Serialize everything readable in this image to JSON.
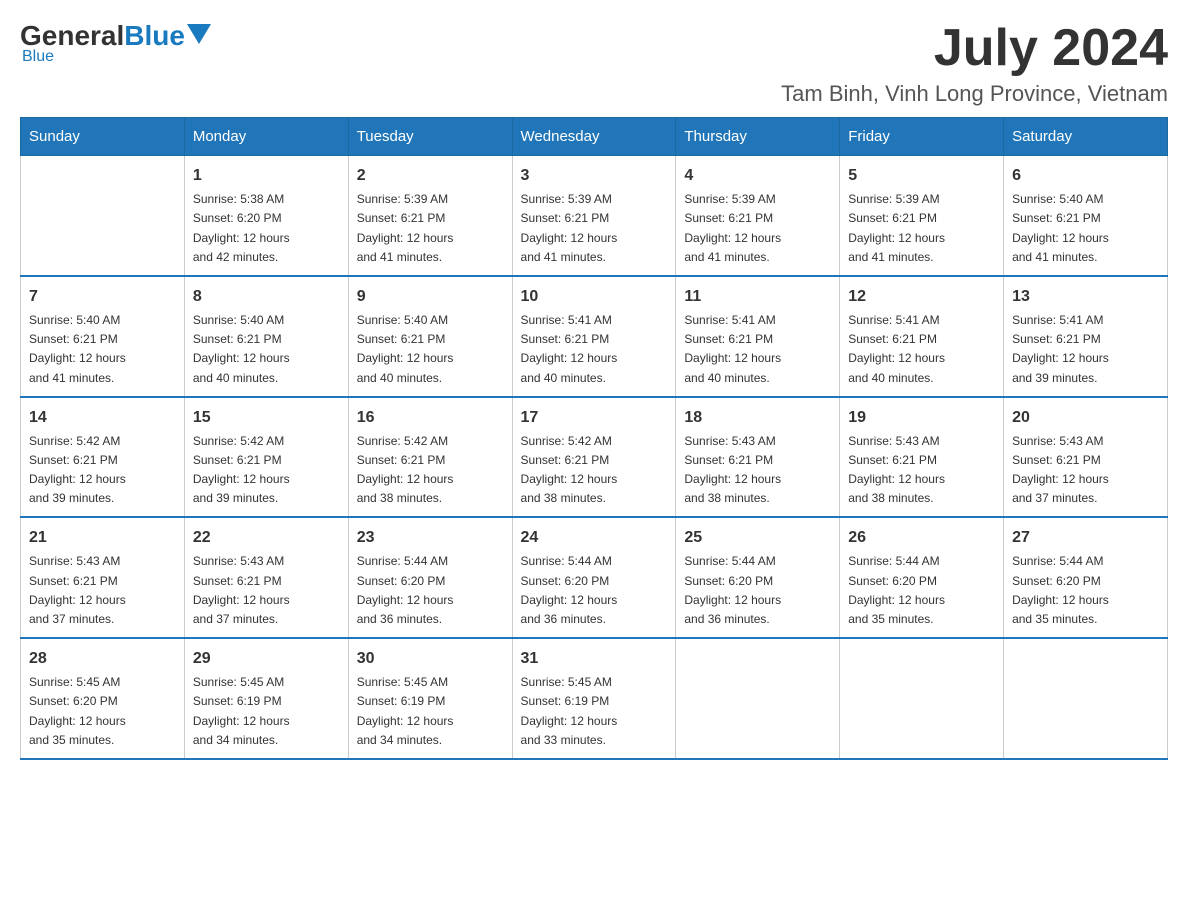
{
  "header": {
    "logo_general": "General",
    "logo_blue": "Blue",
    "month_year": "July 2024",
    "location": "Tam Binh, Vinh Long Province, Vietnam"
  },
  "days_of_week": [
    "Sunday",
    "Monday",
    "Tuesday",
    "Wednesday",
    "Thursday",
    "Friday",
    "Saturday"
  ],
  "weeks": [
    [
      {
        "day": "",
        "info": ""
      },
      {
        "day": "1",
        "info": "Sunrise: 5:38 AM\nSunset: 6:20 PM\nDaylight: 12 hours\nand 42 minutes."
      },
      {
        "day": "2",
        "info": "Sunrise: 5:39 AM\nSunset: 6:21 PM\nDaylight: 12 hours\nand 41 minutes."
      },
      {
        "day": "3",
        "info": "Sunrise: 5:39 AM\nSunset: 6:21 PM\nDaylight: 12 hours\nand 41 minutes."
      },
      {
        "day": "4",
        "info": "Sunrise: 5:39 AM\nSunset: 6:21 PM\nDaylight: 12 hours\nand 41 minutes."
      },
      {
        "day": "5",
        "info": "Sunrise: 5:39 AM\nSunset: 6:21 PM\nDaylight: 12 hours\nand 41 minutes."
      },
      {
        "day": "6",
        "info": "Sunrise: 5:40 AM\nSunset: 6:21 PM\nDaylight: 12 hours\nand 41 minutes."
      }
    ],
    [
      {
        "day": "7",
        "info": "Sunrise: 5:40 AM\nSunset: 6:21 PM\nDaylight: 12 hours\nand 41 minutes."
      },
      {
        "day": "8",
        "info": "Sunrise: 5:40 AM\nSunset: 6:21 PM\nDaylight: 12 hours\nand 40 minutes."
      },
      {
        "day": "9",
        "info": "Sunrise: 5:40 AM\nSunset: 6:21 PM\nDaylight: 12 hours\nand 40 minutes."
      },
      {
        "day": "10",
        "info": "Sunrise: 5:41 AM\nSunset: 6:21 PM\nDaylight: 12 hours\nand 40 minutes."
      },
      {
        "day": "11",
        "info": "Sunrise: 5:41 AM\nSunset: 6:21 PM\nDaylight: 12 hours\nand 40 minutes."
      },
      {
        "day": "12",
        "info": "Sunrise: 5:41 AM\nSunset: 6:21 PM\nDaylight: 12 hours\nand 40 minutes."
      },
      {
        "day": "13",
        "info": "Sunrise: 5:41 AM\nSunset: 6:21 PM\nDaylight: 12 hours\nand 39 minutes."
      }
    ],
    [
      {
        "day": "14",
        "info": "Sunrise: 5:42 AM\nSunset: 6:21 PM\nDaylight: 12 hours\nand 39 minutes."
      },
      {
        "day": "15",
        "info": "Sunrise: 5:42 AM\nSunset: 6:21 PM\nDaylight: 12 hours\nand 39 minutes."
      },
      {
        "day": "16",
        "info": "Sunrise: 5:42 AM\nSunset: 6:21 PM\nDaylight: 12 hours\nand 38 minutes."
      },
      {
        "day": "17",
        "info": "Sunrise: 5:42 AM\nSunset: 6:21 PM\nDaylight: 12 hours\nand 38 minutes."
      },
      {
        "day": "18",
        "info": "Sunrise: 5:43 AM\nSunset: 6:21 PM\nDaylight: 12 hours\nand 38 minutes."
      },
      {
        "day": "19",
        "info": "Sunrise: 5:43 AM\nSunset: 6:21 PM\nDaylight: 12 hours\nand 38 minutes."
      },
      {
        "day": "20",
        "info": "Sunrise: 5:43 AM\nSunset: 6:21 PM\nDaylight: 12 hours\nand 37 minutes."
      }
    ],
    [
      {
        "day": "21",
        "info": "Sunrise: 5:43 AM\nSunset: 6:21 PM\nDaylight: 12 hours\nand 37 minutes."
      },
      {
        "day": "22",
        "info": "Sunrise: 5:43 AM\nSunset: 6:21 PM\nDaylight: 12 hours\nand 37 minutes."
      },
      {
        "day": "23",
        "info": "Sunrise: 5:44 AM\nSunset: 6:20 PM\nDaylight: 12 hours\nand 36 minutes."
      },
      {
        "day": "24",
        "info": "Sunrise: 5:44 AM\nSunset: 6:20 PM\nDaylight: 12 hours\nand 36 minutes."
      },
      {
        "day": "25",
        "info": "Sunrise: 5:44 AM\nSunset: 6:20 PM\nDaylight: 12 hours\nand 36 minutes."
      },
      {
        "day": "26",
        "info": "Sunrise: 5:44 AM\nSunset: 6:20 PM\nDaylight: 12 hours\nand 35 minutes."
      },
      {
        "day": "27",
        "info": "Sunrise: 5:44 AM\nSunset: 6:20 PM\nDaylight: 12 hours\nand 35 minutes."
      }
    ],
    [
      {
        "day": "28",
        "info": "Sunrise: 5:45 AM\nSunset: 6:20 PM\nDaylight: 12 hours\nand 35 minutes."
      },
      {
        "day": "29",
        "info": "Sunrise: 5:45 AM\nSunset: 6:19 PM\nDaylight: 12 hours\nand 34 minutes."
      },
      {
        "day": "30",
        "info": "Sunrise: 5:45 AM\nSunset: 6:19 PM\nDaylight: 12 hours\nand 34 minutes."
      },
      {
        "day": "31",
        "info": "Sunrise: 5:45 AM\nSunset: 6:19 PM\nDaylight: 12 hours\nand 33 minutes."
      },
      {
        "day": "",
        "info": ""
      },
      {
        "day": "",
        "info": ""
      },
      {
        "day": "",
        "info": ""
      }
    ]
  ]
}
